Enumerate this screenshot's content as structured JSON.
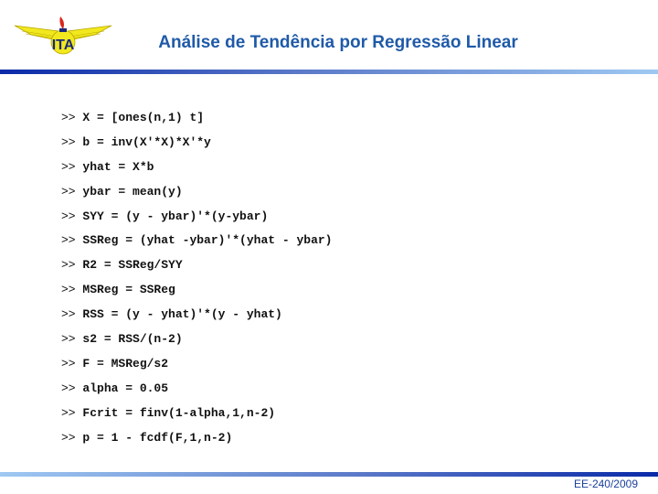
{
  "header": {
    "logo": "ita-wings-logo",
    "title": "Análise de Tendência por Regressão Linear",
    "colors": {
      "title": "#1f5aa8",
      "bar_dark": "#0a2aa8",
      "bar_light": "#9fc8f2"
    }
  },
  "code": {
    "prompt": ">>",
    "lines": [
      "X = [ones(n,1) t]",
      "b = inv(X'*X)*X'*y",
      "yhat = X*b",
      "ybar = mean(y)",
      "SYY = (y - ybar)'*(y-ybar)",
      "SSReg = (yhat -ybar)'*(yhat - ybar)",
      "R2 = SSReg/SYY",
      "MSReg = SSReg",
      "RSS = (y - yhat)'*(y - yhat)",
      "s2 = RSS/(n-2)",
      "F = MSReg/s2",
      "alpha = 0.05",
      "Fcrit = finv(1-alpha,1,n-2)",
      "p = 1 - fcdf(F,1,n-2)"
    ]
  },
  "footer": {
    "course": "EE-240/2009"
  }
}
